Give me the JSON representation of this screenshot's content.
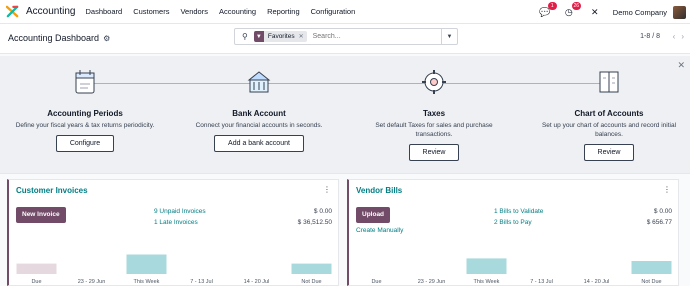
{
  "topbar": {
    "app_name": "Accounting",
    "menu": [
      "Dashboard",
      "Customers",
      "Vendors",
      "Accounting",
      "Reporting",
      "Configuration"
    ],
    "chat_badge": "1",
    "activity_badge": "26",
    "company": "Demo Company"
  },
  "control": {
    "title": "Accounting Dashboard",
    "facet_label": "Favorites",
    "search_placeholder": "Search...",
    "pager": "1-8 / 8"
  },
  "onboarding": {
    "steps": [
      {
        "title": "Accounting Periods",
        "desc": "Define your fiscal years & tax returns periodicity.",
        "button": "Configure"
      },
      {
        "title": "Bank Account",
        "desc": "Connect your financial accounts in seconds.",
        "button": "Add a bank account"
      },
      {
        "title": "Taxes",
        "desc": "Set default Taxes for sales and purchase transactions.",
        "button": "Review"
      },
      {
        "title": "Chart of Accounts",
        "desc": "Set up your chart of accounts and record initial balances.",
        "button": "Review"
      }
    ]
  },
  "cards": [
    {
      "title": "Customer Invoices",
      "primary": "New Invoice",
      "link1": "9 Unpaid Invoices",
      "amount1": "$ 0.00",
      "link2": "1 Late Invoices",
      "amount2": "$ 36,512.50",
      "extra_link": ""
    },
    {
      "title": "Vendor Bills",
      "primary": "Upload",
      "link1": "1 Bills to Validate",
      "amount1": "$ 0.00",
      "link2": "2 Bills to Pay",
      "amount2": "$ 656.77",
      "extra_link": "Create Manually"
    }
  ],
  "chart_data": [
    {
      "type": "bar",
      "categories": [
        "Due",
        "23 - 29 Jun",
        "This Week",
        "7 - 13 Jul",
        "14 - 20 Jul",
        "Not Due"
      ],
      "values": [
        0.4,
        0,
        0.75,
        0,
        0,
        0.4
      ],
      "colors": [
        "#e5d9df",
        "#a8d9dc",
        "#a8d9dc",
        "#a8d9dc",
        "#a8d9dc",
        "#a8d9dc"
      ]
    },
    {
      "type": "bar",
      "categories": [
        "Due",
        "23 - 29 Jun",
        "This Week",
        "7 - 13 Jul",
        "14 - 20 Jul",
        "Not Due"
      ],
      "values": [
        0,
        0,
        0.6,
        0,
        0,
        0.5
      ],
      "colors": [
        "#a8d9dc",
        "#a8d9dc",
        "#a8d9dc",
        "#a8d9dc",
        "#a8d9dc",
        "#a8d9dc"
      ]
    }
  ]
}
